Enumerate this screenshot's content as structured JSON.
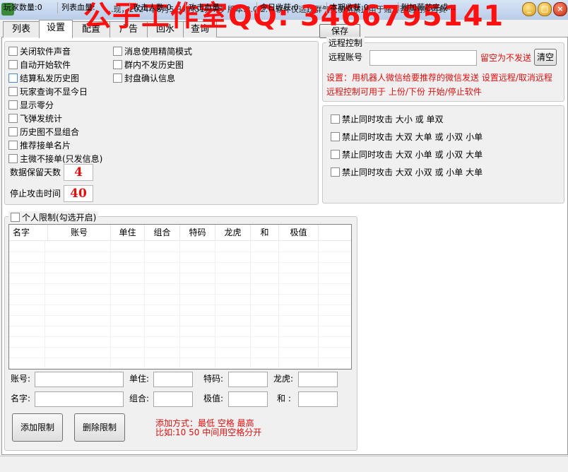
{
  "window": {
    "title": "...现，2024年8月5日7时51分7秒 版本:2.0.2.7 软件仅适跃群气氛使用禁止用于赌博否则后果自负",
    "watermark": "公子工作室QQ: 3466795141"
  },
  "tabs": [
    "列表",
    "设置",
    "配置",
    "广告",
    "回水",
    "查询"
  ],
  "active_tab": "设置",
  "save_label": "保存",
  "settings": {
    "col1": [
      "关闭软件声音",
      "自动开始软件",
      "结算私发历史图",
      "玩家查询不显今日",
      "显示零分",
      "飞弹发统计",
      "历史图不显组合",
      "推荐接单名片",
      "主微不接单(只发信息)"
    ],
    "col2": [
      "消息使用精简模式",
      "群内不发历史图",
      "封盘确认信息"
    ],
    "keep_days_label": "数据保留天数",
    "keep_days": "4",
    "stop_time_label": "停止攻击时间",
    "stop_time": "40"
  },
  "remote": {
    "title": "远程控制",
    "account_label": "远程账号",
    "account_value": "",
    "hint": "留空为不发送",
    "clear": "清空",
    "desc1": "设置：用机器人微信给要推荐的微信发送  设置远程/取消远程",
    "desc2": "远程控制可用于  上份/下份  开始/停止软件"
  },
  "attack": [
    "禁止同时攻击  大小  或  单双",
    "禁止同时攻击  大双  大单  或  小双  小单",
    "禁止同时攻击  大双  小单  或  小双  大单",
    "禁止同时攻击  大双  小双  或  小单  大单"
  ],
  "personal": {
    "title": "个人限制(勾选开启)",
    "columns": [
      "名字",
      "账号",
      "单住",
      "组合",
      "特码",
      "龙虎",
      "和",
      "极值"
    ],
    "labels": {
      "account": "账号:",
      "single": "单住:",
      "special": "特码:",
      "dragon": "龙虎:",
      "name": "名字:",
      "combo": "组合:",
      "extreme": "极值:",
      "he": "和 :"
    },
    "add_btn": "添加限制",
    "del_btn": "删除限制",
    "tip1": "添加方式：最低 空格 最高",
    "tip2": "比如:10  50  中间用空格分开"
  },
  "status": [
    "玩家数量:0",
    "列表血量:",
    "攻击人数:0",
    "攻击血量:",
    "今日收获:0",
    "本期收获:0",
    "附加薇芯完成..."
  ]
}
